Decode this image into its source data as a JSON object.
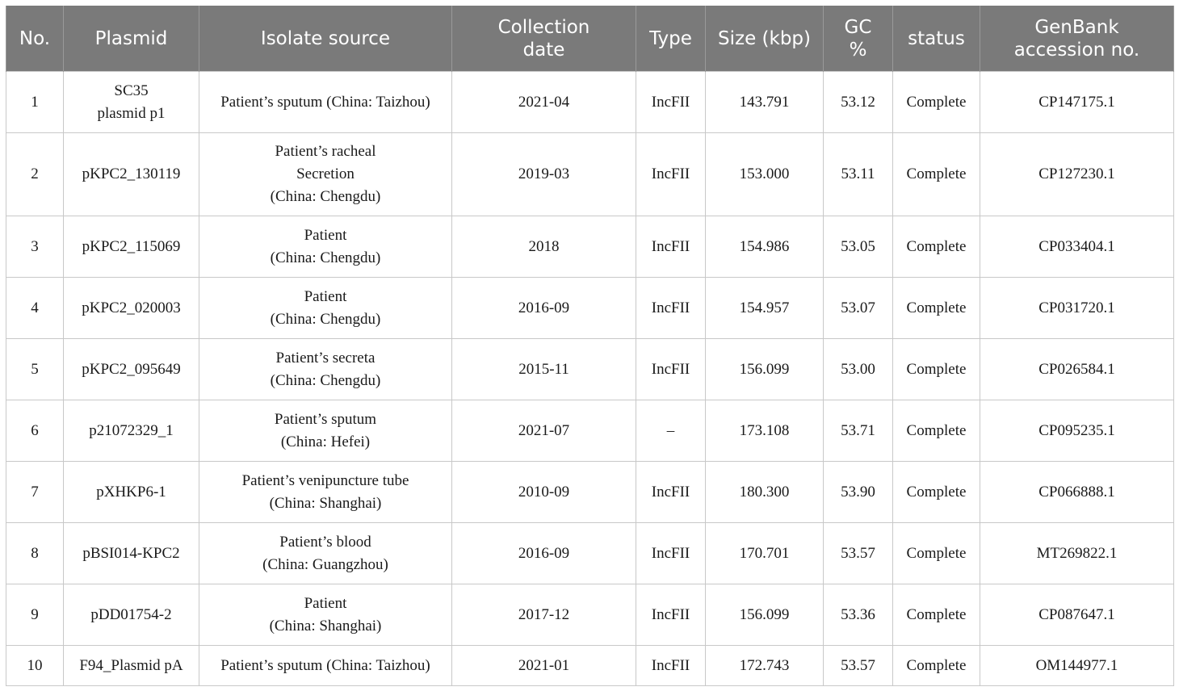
{
  "table": {
    "headers": [
      [
        "No."
      ],
      [
        "Plasmid"
      ],
      [
        "Isolate source"
      ],
      [
        "Collection",
        "date"
      ],
      [
        "Type"
      ],
      [
        "Size (kbp)"
      ],
      [
        "GC",
        "%"
      ],
      [
        "status"
      ],
      [
        "GenBank",
        "accession no."
      ]
    ],
    "rows": [
      {
        "no": "1",
        "plasmid": [
          "SC35",
          "plasmid p1"
        ],
        "source": [
          "Patient’s sputum (China: Taizhou)"
        ],
        "date": "2021-04",
        "type": "IncFII",
        "size": "143.791",
        "gc": "53.12",
        "status": "Complete",
        "accession": "CP147175.1"
      },
      {
        "no": "2",
        "plasmid": [
          "pKPC2_130119"
        ],
        "source": [
          "Patient’s racheal",
          "Secretion",
          "(China: Chengdu)"
        ],
        "date": "2019-03",
        "type": "IncFII",
        "size": "153.000",
        "gc": "53.11",
        "status": "Complete",
        "accession": "CP127230.1"
      },
      {
        "no": "3",
        "plasmid": [
          "pKPC2_115069"
        ],
        "source": [
          "Patient",
          "(China: Chengdu)"
        ],
        "date": "2018",
        "type": "IncFII",
        "size": "154.986",
        "gc": "53.05",
        "status": "Complete",
        "accession": "CP033404.1"
      },
      {
        "no": "4",
        "plasmid": [
          "pKPC2_020003"
        ],
        "source": [
          "Patient",
          "(China: Chengdu)"
        ],
        "date": "2016-09",
        "type": "IncFII",
        "size": "154.957",
        "gc": "53.07",
        "status": "Complete",
        "accession": "CP031720.1"
      },
      {
        "no": "5",
        "plasmid": [
          "pKPC2_095649"
        ],
        "source": [
          "Patient’s secreta",
          "(China: Chengdu)"
        ],
        "date": "2015-11",
        "type": "IncFII",
        "size": "156.099",
        "gc": "53.00",
        "status": "Complete",
        "accession": "CP026584.1"
      },
      {
        "no": "6",
        "plasmid": [
          "p21072329_1"
        ],
        "source": [
          "Patient’s sputum",
          "(China: Hefei)"
        ],
        "date": "2021-07",
        "type": "–",
        "size": "173.108",
        "gc": "53.71",
        "status": "Complete",
        "accession": "CP095235.1"
      },
      {
        "no": "7",
        "plasmid": [
          "pXHKP6-1"
        ],
        "source": [
          "Patient’s venipuncture tube",
          "(China: Shanghai)"
        ],
        "date": "2010-09",
        "type": "IncFII",
        "size": "180.300",
        "gc": "53.90",
        "status": "Complete",
        "accession": "CP066888.1"
      },
      {
        "no": "8",
        "plasmid": [
          "pBSI014-KPC2"
        ],
        "source": [
          "Patient’s blood",
          "(China: Guangzhou)"
        ],
        "date": "2016-09",
        "type": "IncFII",
        "size": "170.701",
        "gc": "53.57",
        "status": "Complete",
        "accession": "MT269822.1"
      },
      {
        "no": "9",
        "plasmid": [
          "pDD01754-2"
        ],
        "source": [
          "Patient",
          "(China: Shanghai)"
        ],
        "date": "2017-12",
        "type": "IncFII",
        "size": "156.099",
        "gc": "53.36",
        "status": "Complete",
        "accession": "CP087647.1"
      },
      {
        "no": "10",
        "plasmid": [
          "F94_Plasmid pA"
        ],
        "source": [
          "Patient’s sputum (China: Taizhou)"
        ],
        "date": "2021-01",
        "type": "IncFII",
        "size": "172.743",
        "gc": "53.57",
        "status": "Complete",
        "accession": "OM144977.1"
      }
    ]
  }
}
